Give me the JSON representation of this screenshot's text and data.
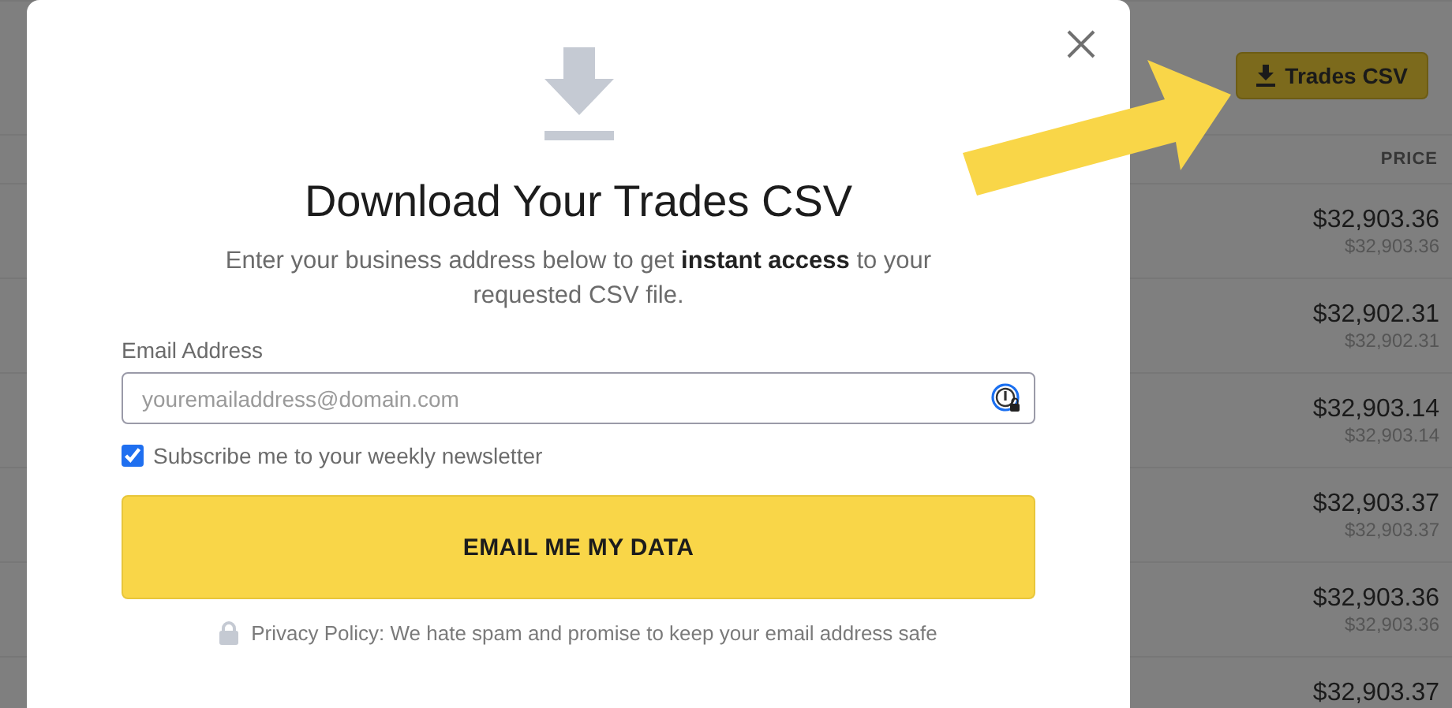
{
  "toolbar": {
    "export_button": "Trades CSV"
  },
  "table": {
    "columns": [
      "PRICE"
    ],
    "rows": [
      {
        "price": "$32,903.36",
        "sub_price": "$32,903.36"
      },
      {
        "price": "$32,902.31",
        "sub_price": "$32,902.31"
      },
      {
        "price": "$32,903.14",
        "sub_price": "$32,903.14"
      },
      {
        "price": "$32,903.37",
        "sub_price": "$32,903.37"
      },
      {
        "price": "$32,903.36",
        "sub_price": "$32,903.36"
      },
      {
        "price": "$32,903.37"
      }
    ]
  },
  "modal": {
    "title": "Download Your Trades CSV",
    "description": "Enter your business address below to get **instant access** to your requested CSV file.",
    "email_label": "Email Address",
    "email_placeholder": "youremailaddress@domain.com",
    "newsletter": {
      "label": "Subscribe me to your weekly newsletter",
      "checked": true
    },
    "submit_button": "EMAIL ME MY DATA",
    "privacy_note": "Privacy Policy: We hate spam and promise to keep your email address safe"
  }
}
